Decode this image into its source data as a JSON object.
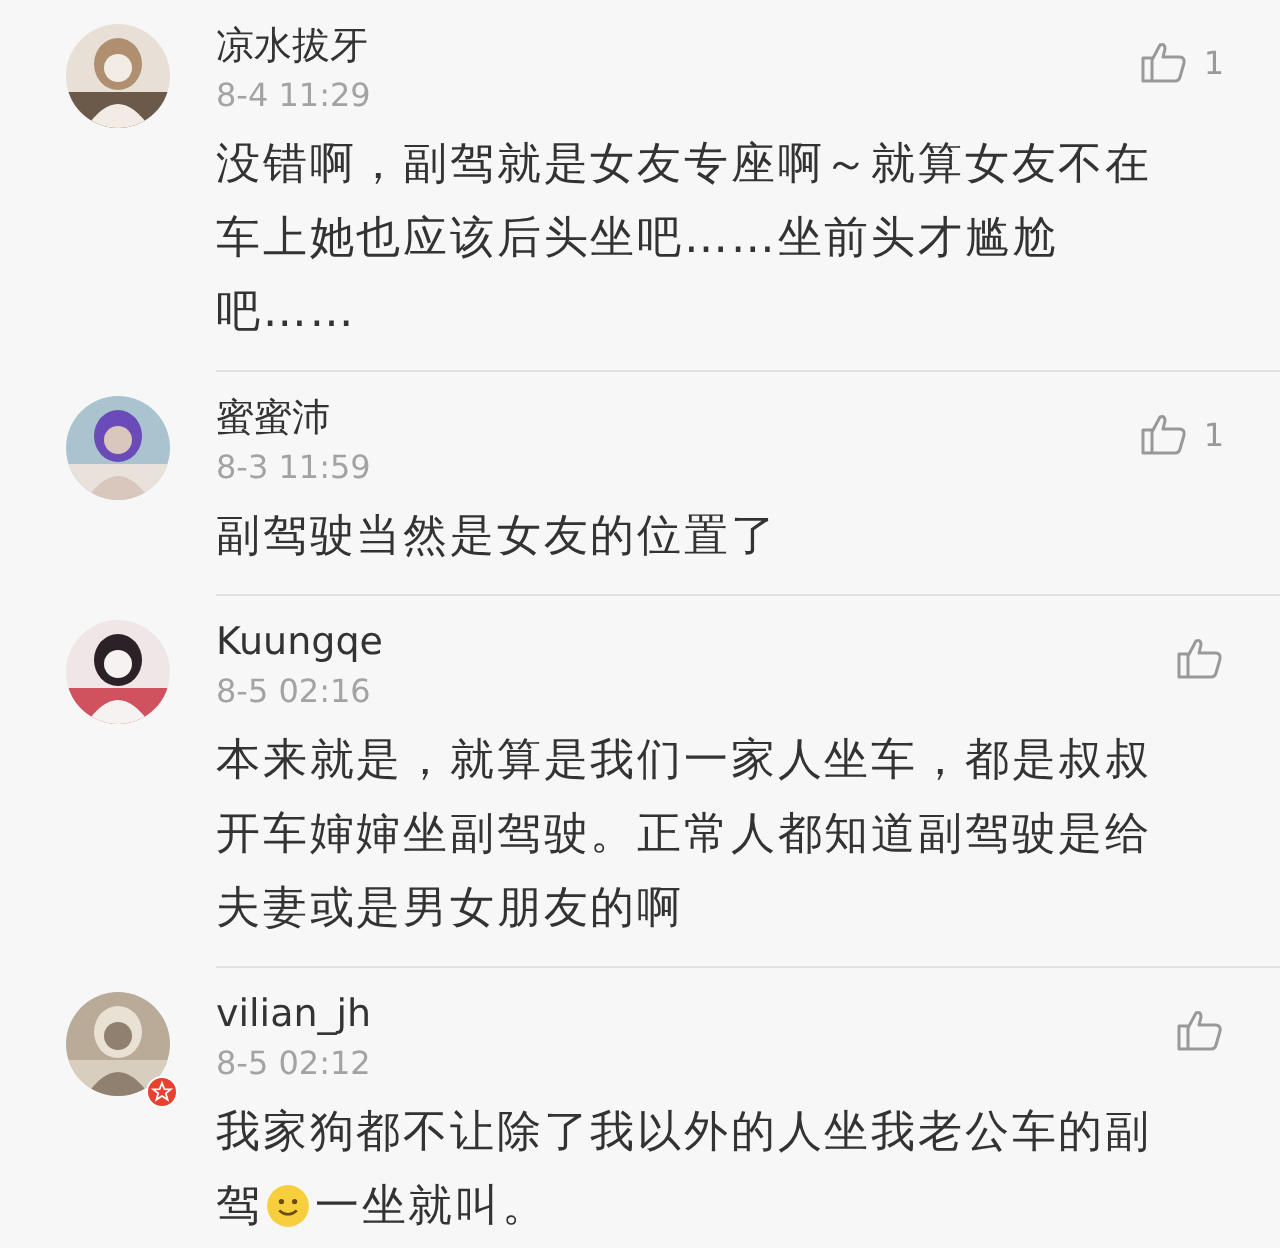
{
  "comments": [
    {
      "user": "凉水拔牙",
      "time": "8-4 11:29",
      "likes": "1",
      "badge": false,
      "body": [
        {
          "kind": "text",
          "text": "没错啊，副驾就是女友专座啊～就算女友不在车上她也应该后头坐吧……坐前头才尴尬吧……"
        }
      ]
    },
    {
      "user": "蜜蜜沛",
      "time": "8-3 11:59",
      "likes": "1",
      "badge": false,
      "body": [
        {
          "kind": "text",
          "text": "副驾驶当然是女友的位置了"
        }
      ]
    },
    {
      "user": "Kuungqe",
      "time": "8-5 02:16",
      "badge": false,
      "body": [
        {
          "kind": "text",
          "text": "本来就是，就算是我们一家人坐车，都是叔叔开车婶婶坐副驾驶。正常人都知道副驾驶是给夫妻或是男女朋友的啊"
        }
      ]
    },
    {
      "user": "vilian_jh",
      "time": "8-5 02:12",
      "badge": true,
      "body": [
        {
          "kind": "text",
          "text": "我家狗都不让除了我以外的人坐我老公车的副驾"
        },
        {
          "kind": "emoji"
        },
        {
          "kind": "text",
          "text": "一坐就叫。"
        }
      ]
    }
  ]
}
